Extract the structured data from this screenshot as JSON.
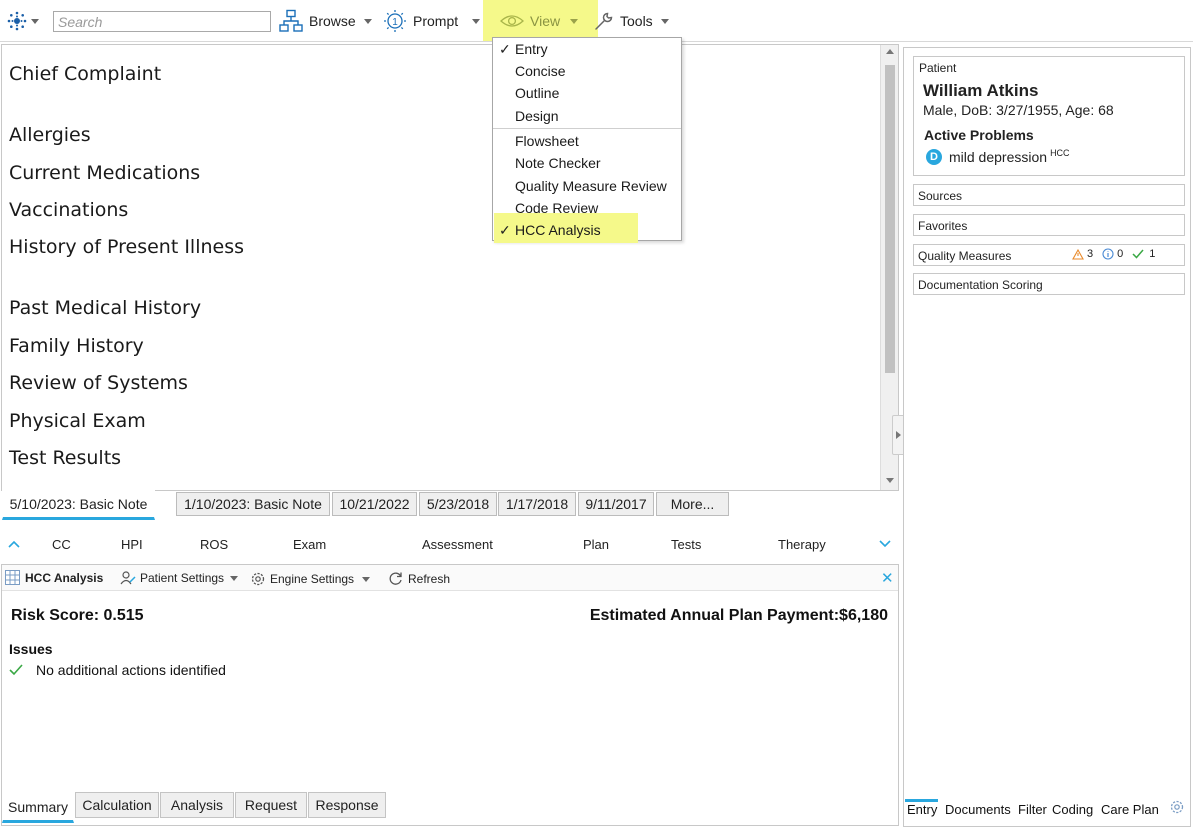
{
  "toolbar": {
    "search_placeholder": "Search",
    "browse": "Browse",
    "prompt": "Prompt",
    "view": "View",
    "tools": "Tools"
  },
  "view_menu": {
    "items": [
      "Entry",
      "Concise",
      "Outline",
      "Design"
    ],
    "items2": [
      "Flowsheet",
      "Note Checker",
      "Quality Measure Review",
      "Code Review",
      "HCC Analysis"
    ],
    "check": "✓"
  },
  "sections": [
    "Chief Complaint",
    "Allergies",
    "Current Medications",
    "Vaccinations",
    "History of Present Illness",
    "Past Medical History",
    "Family History",
    "Review of Systems",
    "Physical Exam",
    "Test Results"
  ],
  "note_tabs": [
    "5/10/2023: Basic Note",
    "1/10/2023: Basic Note",
    "10/21/2022",
    "5/23/2018",
    "1/17/2018",
    "9/11/2017",
    "More..."
  ],
  "strip": [
    "CC",
    "HPI",
    "ROS",
    "Exam",
    "Assessment",
    "Plan",
    "Tests",
    "Therapy"
  ],
  "hcc": {
    "title": "HCC Analysis",
    "patient_settings": "Patient Settings",
    "engine_settings": "Engine Settings",
    "refresh": "Refresh",
    "risk_score": "Risk Score: 0.515",
    "payment": "Estimated Annual Plan Payment:$6,180",
    "issues_title": "Issues",
    "issue": "No additional actions identified",
    "tabs": [
      "Summary",
      "Calculation",
      "Analysis",
      "Request",
      "Response"
    ]
  },
  "patient": {
    "label": "Patient",
    "name": "William Atkins",
    "demographics": "Male, DoB: 3/27/1955, Age: 68",
    "problems_title": "Active Problems",
    "problem_badge": "D",
    "problem": "mild depression",
    "problem_sup": "HCC"
  },
  "cards": {
    "sources": "Sources",
    "favorites": "Favorites",
    "quality": "Quality Measures",
    "q_warn": "3",
    "q_info": "0",
    "q_ok": "1",
    "scoring": "Documentation Scoring"
  },
  "right_tabs": [
    "Entry",
    "Documents",
    "Filter",
    "Coding",
    "Care Plan"
  ],
  "colors": {
    "accent": "#29a7de",
    "highlight": "#f5f98a",
    "green": "#3aa845",
    "warning": "#e98a2b"
  }
}
